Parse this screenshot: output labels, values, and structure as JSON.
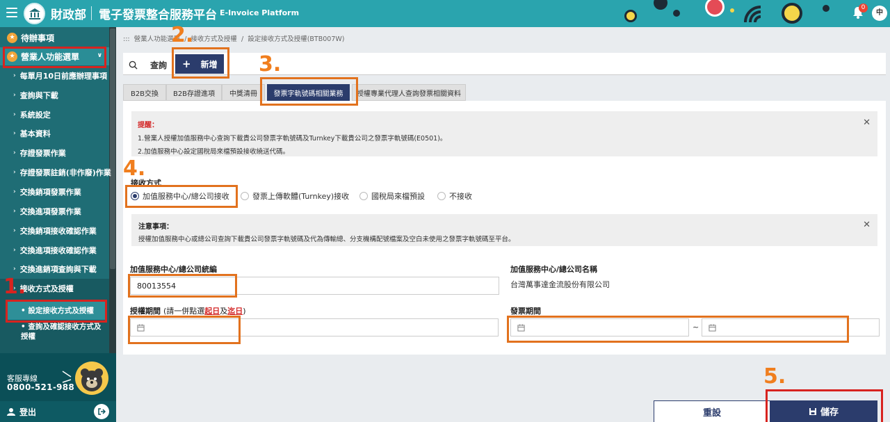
{
  "topbar": {
    "ministry": "財政部",
    "platform": "電子發票整合服務平台",
    "platform_en": "E-Invoice Platform",
    "notification_count": "0",
    "user_initial": "中",
    "accent": "#2aa4ae"
  },
  "sidebar": {
    "pending": "待辦事項",
    "menu": "營業人功能選單",
    "items": [
      "每單月10日前應辦理事項",
      "查詢與下載",
      "系統設定",
      "基本資料",
      "存證發票作業",
      "存證發票註銷(非作廢)作業",
      "交換銷項發票作業",
      "交換進項發票作業",
      "交換銷項接收確認作業",
      "交換進項接收確認作業",
      "交換進銷項查詢與下載",
      "接收方式及授權"
    ],
    "sub_items": [
      "設定接收方式及授權",
      "查詢及確認接收方式及授權"
    ],
    "hotline_label": "客服專線",
    "hotline_number": "0800-521-988",
    "logout": "登出"
  },
  "breadcrumb": {
    "prefix": ":::",
    "items": [
      "營業人功能選單",
      "接收方式及授權",
      "設定接收方式及授權(BTB007W)"
    ],
    "sep": "/"
  },
  "modes": {
    "query": "查詢",
    "add": "新增"
  },
  "subtabs": [
    "B2B交換",
    "B2B存證進項",
    "中獎清冊",
    "發票字軌號碼相關業務",
    "授權專業代理人查詢發票相關資料"
  ],
  "reminder": {
    "title": "提醒：",
    "line1": "1.營業人授權加值服務中心查詢下載貴公司發票字軌號碼及Turnkey下載貴公司之發票字軌號碼(E0501)。",
    "line2": "2.加值服務中心設定國稅局來檔預設接收繞送代碼。"
  },
  "receive": {
    "label": "接收方式",
    "options": [
      "加值服務中心/總公司接收",
      "發票上傳軟體(Turnkey)接收",
      "國稅局來檔預設",
      "不接收"
    ],
    "selected_index": 0
  },
  "notice": {
    "title": "注意事項：",
    "body": "授權加值服務中心或總公司查詢下載貴公司發票字軌號碼及代為傳輸總、分支機構配號檔案及空白未使用之發票字軌號碼至平台。"
  },
  "form": {
    "vat_label": "加值服務中心/總公司統編",
    "vat_value": "80013554",
    "name_label": "加值服務中心/總公司名稱",
    "name_value": "台灣萬事達金流股份有限公司",
    "auth_label": "授權期間",
    "auth_hint_pre": "(請一併點選",
    "auth_hint_start": "起日",
    "auth_hint_mid": "及",
    "auth_hint_end": "迄日",
    "auth_hint_post": ")",
    "invoice_label": "發票期間",
    "range_sep": "~"
  },
  "steps": [
    "1.",
    "2.",
    "3.",
    "4.",
    "5."
  ],
  "buttons": {
    "reset": "重設",
    "save": "儲存"
  },
  "colors": {
    "navy": "#2b3c6c",
    "orange_annotation": "#e2721e",
    "red_annotation": "#d8231f",
    "alert_red": "#d42a2a"
  }
}
